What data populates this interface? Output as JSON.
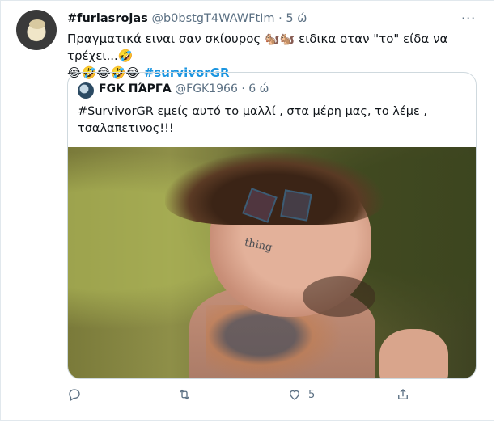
{
  "tweet": {
    "display_name": "#furiasrojas",
    "handle": "@b0bstgT4WAWFtIm",
    "separator": "·",
    "time": "5 ώ",
    "more_label": "···",
    "text_part1": "Πραγματικά ειναι σαν σκίουρος 🐿️🐿️ ειδικα οταν \"το\" είδα να τρέχει...🤣",
    "text_part2": "😂🤣😂🤣😂",
    "hashtag": "#survivorGR"
  },
  "quote": {
    "display_name": "FGK ΠΆΡΓΑ",
    "handle": "@FGK1966",
    "separator": "·",
    "time": "6 ώ",
    "text": "#SurvivorGR εμείς  αυτό  το μαλλί , στα μέρη  μας, το λέμε , τσαλαπετινος!!!",
    "image_tattoo_text": "thing"
  },
  "actions": {
    "reply_count": "",
    "retweet_count": "",
    "like_count": "5",
    "share_count": ""
  },
  "colors": {
    "accent": "#1b95e0",
    "muted": "#5b7083",
    "border": "#cfd9de"
  },
  "icons": [
    "reply-icon",
    "retweet-icon",
    "like-icon",
    "share-icon",
    "more-icon"
  ]
}
